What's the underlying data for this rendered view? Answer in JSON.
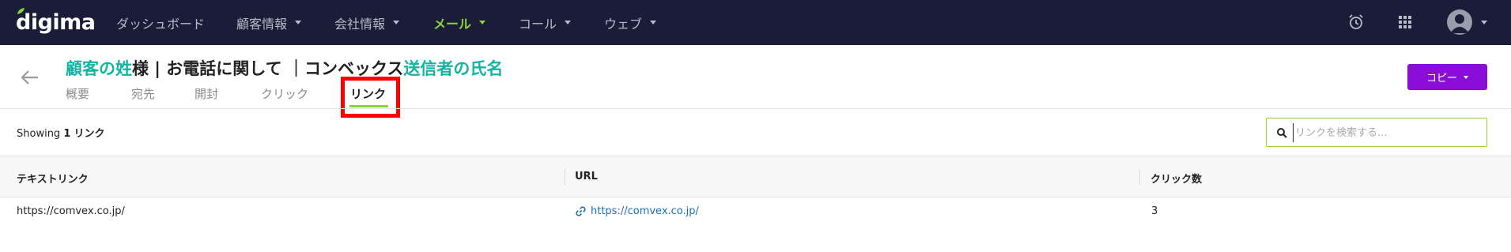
{
  "app": {
    "logo": "digima",
    "colors": {
      "nav_bg": "#1b1c37",
      "accent_green": "#8bd437",
      "teal": "#15b3a2",
      "purple": "#8a0ed8",
      "link_blue": "#1a6fb0",
      "highlight_red": "#ff0000"
    }
  },
  "nav": {
    "items": [
      {
        "label": "ダッシュボード",
        "has_caret": false,
        "active": false
      },
      {
        "label": "顧客情報",
        "has_caret": true,
        "active": false
      },
      {
        "label": "会社情報",
        "has_caret": true,
        "active": false
      },
      {
        "label": "メール",
        "has_caret": true,
        "active": true
      },
      {
        "label": "コール",
        "has_caret": true,
        "active": false
      },
      {
        "label": "ウェブ",
        "has_caret": true,
        "active": false
      }
    ],
    "icons": [
      "alarm-clock-icon",
      "apps-grid-icon",
      "user-avatar-icon"
    ]
  },
  "header": {
    "title_parts": {
      "p1": "顧客の姓",
      "p2": "様 | お電話に関して ｜コンベックス",
      "p3": "送信者の氏名"
    },
    "tabs": [
      "概要",
      "宛先",
      "開封",
      "クリック",
      "リンク"
    ],
    "active_tab": "リンク",
    "copy_button": "コピー"
  },
  "toolbar": {
    "showing_prefix": "Showing",
    "showing_count": "1",
    "showing_suffix": "リンク",
    "search_placeholder": "リンクを検索する..."
  },
  "table": {
    "columns": [
      "テキストリンク",
      "URL",
      "クリック数"
    ],
    "rows": [
      {
        "text_link": "https://comvex.co.jp/",
        "url": "https://comvex.co.jp/",
        "clicks": "3"
      }
    ]
  }
}
